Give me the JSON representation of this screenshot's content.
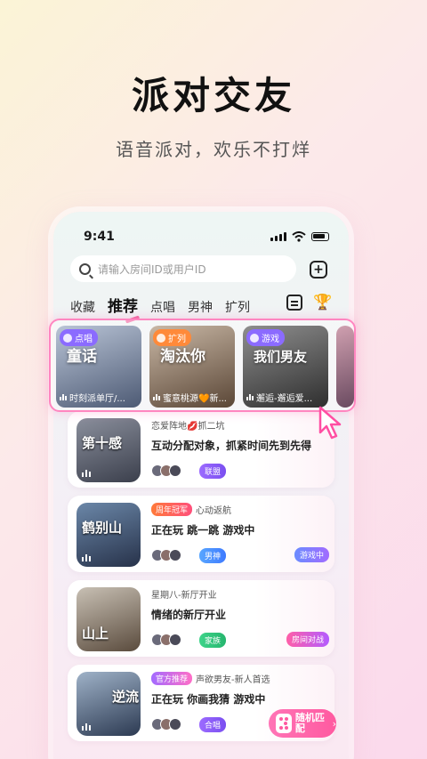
{
  "hero": {
    "title": "派对交友",
    "subtitle": "语音派对，欢乐不打烊"
  },
  "status_bar": {
    "time": "9:41"
  },
  "search": {
    "placeholder": "请输入房间ID或用户ID"
  },
  "tabs": [
    {
      "label": "收藏",
      "active": false
    },
    {
      "label": "推荐",
      "active": true
    },
    {
      "label": "点唱",
      "active": false
    },
    {
      "label": "男神",
      "active": false
    },
    {
      "label": "扩列",
      "active": false
    }
  ],
  "featured": [
    {
      "badge": "点唱",
      "caption": "童话",
      "title": "时刻派单厅/...",
      "color": "#8b6bff"
    },
    {
      "badge": "扩列",
      "caption": "淘汰你",
      "title": "蜜意桃源🧡新...",
      "color": "#ff8a3a"
    },
    {
      "badge": "游戏",
      "caption": "我们男友",
      "title": "邂逅-邂逅爱...",
      "color": "#8b6bff"
    }
  ],
  "rooms": [
    {
      "thumb_caption": "第十感",
      "title": "恋爱阵地💋抓二坑",
      "status": "互动分配对象，抓紧时间先到先得",
      "tag": "联盟",
      "tag_color": "violet"
    },
    {
      "thumb_caption": "鹤别山",
      "badge": "周年冠军",
      "title": "心动返航",
      "status": "正在玩 跳一跳 游戏中",
      "tag": "男神",
      "tag_color": "blue",
      "side_tag": "游戏中"
    },
    {
      "thumb_caption": "山上",
      "title": "星期八-新厅开业",
      "status": "情绪的新厅开业",
      "tag": "家族",
      "tag_color": "green",
      "side_tag": "房间对战"
    },
    {
      "thumb_caption": "逆流",
      "badge": "官方推荐",
      "title": "声欲男友-新人首选",
      "status": "正在玩 你画我猜 游戏中",
      "tag": "合唱",
      "tag_color": "violet"
    }
  ],
  "random_match": {
    "label": "随机匹配"
  },
  "icons": {
    "search": "search-icon",
    "add": "add-room-icon",
    "calendar": "calendar-icon",
    "trophy": "trophy-icon",
    "cursor": "pointer-cursor-icon",
    "dice": "dice-icon"
  }
}
